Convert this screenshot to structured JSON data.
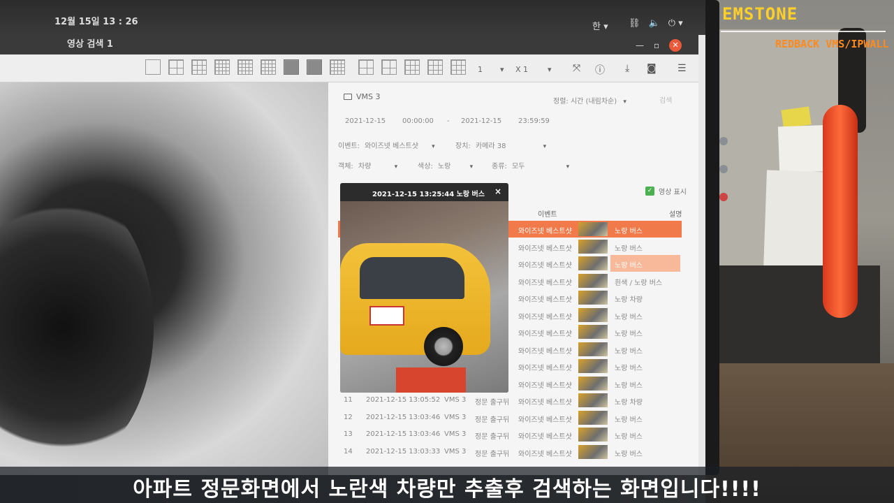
{
  "top_bar": {
    "date": "12월 15일 13 : 26",
    "lang": "한 ▾",
    "icons": [
      "network-icon",
      "volume-icon",
      "power-icon"
    ]
  },
  "window": {
    "tab_title": "영상 검색 1",
    "buttons": [
      "—",
      "▫",
      "✕"
    ]
  },
  "toolbar": {
    "page_select": "1",
    "speed_select": "X 1",
    "icons": [
      "fullscreen-icon",
      "info-icon",
      "download-icon",
      "camera-icon",
      "list-icon"
    ]
  },
  "panel": {
    "title": "VMS 3",
    "sort_label": "정렬:",
    "sort_value": "시간 (내림차순)",
    "lookup_button": "검색",
    "start_date": "2021-12-15",
    "start_time": "00:00:00",
    "range_sep": "-",
    "end_date": "2021-12-15",
    "end_time": "23:59:59",
    "event_label": "이벤트:",
    "event_value": "와이즈넷 베스트샷",
    "device_label": "장치:",
    "device_value": "카메라 38",
    "object_label": "객체:",
    "object_value": "차량",
    "color_label": "색상:",
    "color_value": "노랑",
    "kind_label": "종류:",
    "kind_value": "모두",
    "show_video_label": "영상 표시",
    "col_event": "이벤트",
    "col_desc": "설명"
  },
  "rows": [
    {
      "event": "와이즈넷 베스트샷",
      "desc": "노랑 버스"
    },
    {
      "event": "와이즈넷 베스트샷",
      "desc": "노랑 버스"
    },
    {
      "event": "와이즈넷 베스트샷",
      "desc": "노랑 버스"
    },
    {
      "event": "와이즈넷 베스트샷",
      "desc": "흰색 / 노랑 버스"
    },
    {
      "event": "와이즈넷 베스트샷",
      "desc": "노랑 차량"
    },
    {
      "event": "와이즈넷 베스트샷",
      "desc": "노랑 버스"
    },
    {
      "event": "와이즈넷 베스트샷",
      "desc": "노랑 버스"
    },
    {
      "event": "와이즈넷 베스트샷",
      "desc": "노랑 버스"
    },
    {
      "event": "와이즈넷 베스트샷",
      "desc": "노랑 버스"
    },
    {
      "event": "와이즈넷 베스트샷",
      "desc": "노랑 버스"
    },
    {
      "num": "11",
      "time": "2021-12-15 13:05:52",
      "vms": "VMS 3",
      "device": "정문 출구뒤",
      "event": "와이즈넷 베스트샷",
      "desc": "노랑 차량"
    },
    {
      "num": "12",
      "time": "2021-12-15 13:03:46",
      "vms": "VMS 3",
      "device": "정문 출구뒤",
      "event": "와이즈넷 베스트샷",
      "desc": "노랑 버스"
    },
    {
      "num": "13",
      "time": "2021-12-15 13:03:46",
      "vms": "VMS 3",
      "device": "정문 출구뒤",
      "event": "와이즈넷 베스트샷",
      "desc": "노랑 버스"
    },
    {
      "num": "14",
      "time": "2021-12-15 13:03:33",
      "vms": "VMS 3",
      "device": "정문 출구뒤",
      "event": "와이즈넷 베스트샷",
      "desc": "노랑 버스"
    }
  ],
  "popup": {
    "title": "2021-12-15 13:25:44 노랑 버스",
    "close": "×"
  },
  "brand": {
    "logo": "EMSTONE",
    "subtitle": "REDBACK VMS/IPWALL"
  },
  "caption": "아파트 정문화면에서 노란색 차량만 추출후 검색하는 화면입니다!!!!",
  "colors": {
    "selection": "#f07a4a",
    "logo": "#ffd02a",
    "logo_sub": "#ff8a1e"
  }
}
